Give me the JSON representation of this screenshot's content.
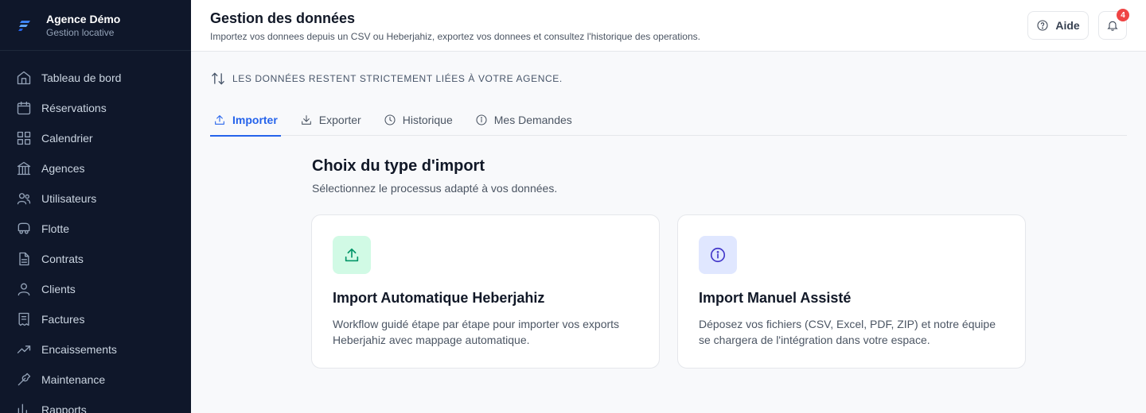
{
  "brand": {
    "name": "Agence Démo",
    "subtitle": "Gestion locative",
    "icon": "brand-logo-icon",
    "accent": "#2563eb"
  },
  "sidebar": {
    "items": [
      {
        "label": "Tableau de bord",
        "icon": "home-icon"
      },
      {
        "label": "Réservations",
        "icon": "calendar-icon"
      },
      {
        "label": "Calendrier",
        "icon": "grid-icon"
      },
      {
        "label": "Agences",
        "icon": "bank-icon"
      },
      {
        "label": "Utilisateurs",
        "icon": "users-icon"
      },
      {
        "label": "Flotte",
        "icon": "car-icon"
      },
      {
        "label": "Contrats",
        "icon": "document-icon"
      },
      {
        "label": "Clients",
        "icon": "user-icon"
      },
      {
        "label": "Factures",
        "icon": "receipt-icon"
      },
      {
        "label": "Encaissements",
        "icon": "trend-up-icon"
      },
      {
        "label": "Maintenance",
        "icon": "wrench-icon"
      },
      {
        "label": "Rapports",
        "icon": "chart-icon"
      }
    ]
  },
  "header": {
    "title": "Gestion des données",
    "subtitle": "Importez vos donnees depuis un CSV ou Heberjahiz, exportez vos donnees et consultez l'historique des operations.",
    "help_label": "Aide",
    "notification_count": "4"
  },
  "notice": {
    "text": "LES DONNÉES RESTENT STRICTEMENT LIÉES À VOTRE AGENCE.",
    "icon": "arrows-up-down-icon"
  },
  "tabs": [
    {
      "label": "Importer",
      "icon": "upload-icon",
      "active": true
    },
    {
      "label": "Exporter",
      "icon": "download-icon",
      "active": false
    },
    {
      "label": "Historique",
      "icon": "clock-icon",
      "active": false
    },
    {
      "label": "Mes Demandes",
      "icon": "info-icon",
      "active": false
    }
  ],
  "main": {
    "title": "Choix du type d'import",
    "subtitle": "Sélectionnez le processus adapté à vos données.",
    "cards": [
      {
        "title": "Import Automatique Heberjahiz",
        "description": "Workflow guidé étape par étape pour importer vos exports Heberjahiz avec mappage automatique.",
        "icon": "upload-icon",
        "color": "#059669"
      },
      {
        "title": "Import Manuel Assisté",
        "description": "Déposez vos fichiers (CSV, Excel, PDF, ZIP) et notre équipe se chargera de l'intégration dans votre espace.",
        "icon": "info-icon",
        "color": "#4338ca"
      }
    ]
  },
  "colors": {
    "sidebar_bg": "#0f172a",
    "badge": "#ef4444",
    "active_tab": "#2563eb"
  }
}
